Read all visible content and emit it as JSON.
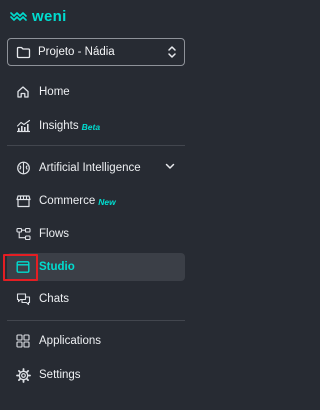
{
  "brand": {
    "logo_text": "weni",
    "accent": "#00ddd0"
  },
  "project": {
    "name": "Projeto - Nádia"
  },
  "nav": {
    "home": {
      "label": "Home"
    },
    "insights": {
      "label": "Insights",
      "badge": "Beta"
    },
    "ai": {
      "label": "Artificial Intelligence"
    },
    "commerce": {
      "label": "Commerce",
      "badge": "New"
    },
    "flows": {
      "label": "Flows"
    },
    "studio": {
      "label": "Studio"
    },
    "chats": {
      "label": "Chats"
    },
    "applications": {
      "label": "Applications"
    },
    "settings": {
      "label": "Settings"
    }
  },
  "icons": {
    "logo": "weni-logo-icon",
    "project": "folder-icon",
    "project_chevron": "chevron-up-down-icon",
    "home": "home-icon",
    "insights": "chart-icon",
    "ai": "brain-icon",
    "ai_expand": "chevron-down-icon",
    "commerce": "store-icon",
    "flows": "flow-icon",
    "studio": "window-icon",
    "chats": "chat-icon",
    "applications": "apps-grid-icon",
    "settings": "gear-icon"
  },
  "active_item": "studio",
  "colors": {
    "background": "#272b33",
    "active_bg": "#3b3f47",
    "highlight": "#e41e23"
  }
}
